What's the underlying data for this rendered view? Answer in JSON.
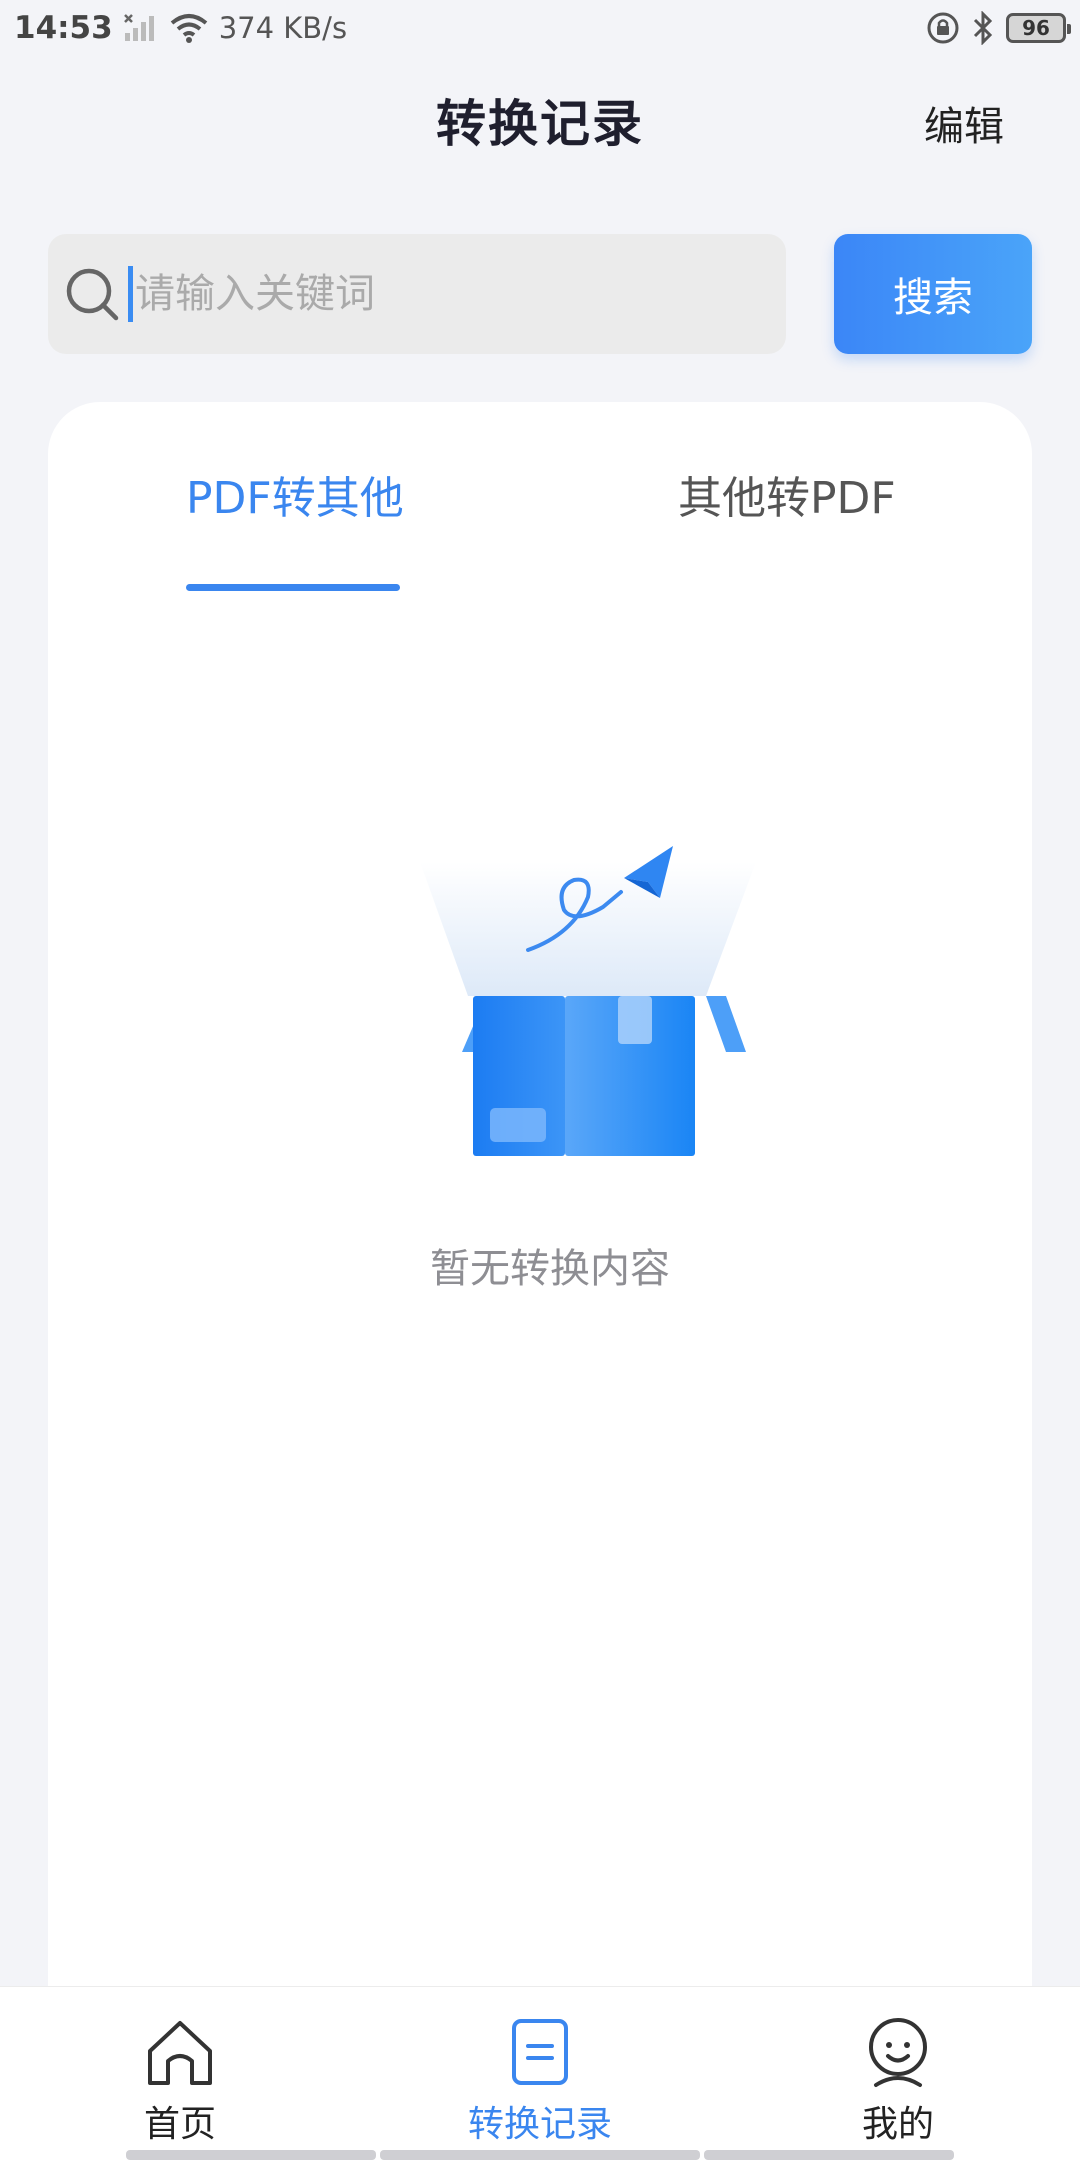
{
  "status_bar": {
    "time": "14:53",
    "speed": "374 KB/s",
    "battery": "96"
  },
  "header": {
    "title": "转换记录",
    "edit_label": "编辑"
  },
  "search": {
    "placeholder": "请输入关键词",
    "value": "",
    "button_label": "搜索"
  },
  "tabs": [
    {
      "label": "PDF转其他",
      "active": true
    },
    {
      "label": "其他转PDF",
      "active": false
    }
  ],
  "empty_state": {
    "text": "暂无转换内容"
  },
  "bottom_nav": [
    {
      "label": "首页",
      "icon": "home-icon",
      "active": false
    },
    {
      "label": "转换记录",
      "icon": "document-icon",
      "active": true
    },
    {
      "label": "我的",
      "icon": "profile-icon",
      "active": false
    }
  ],
  "colors": {
    "accent": "#3a86ef",
    "background": "#f3f4f8",
    "card": "#ffffff"
  }
}
